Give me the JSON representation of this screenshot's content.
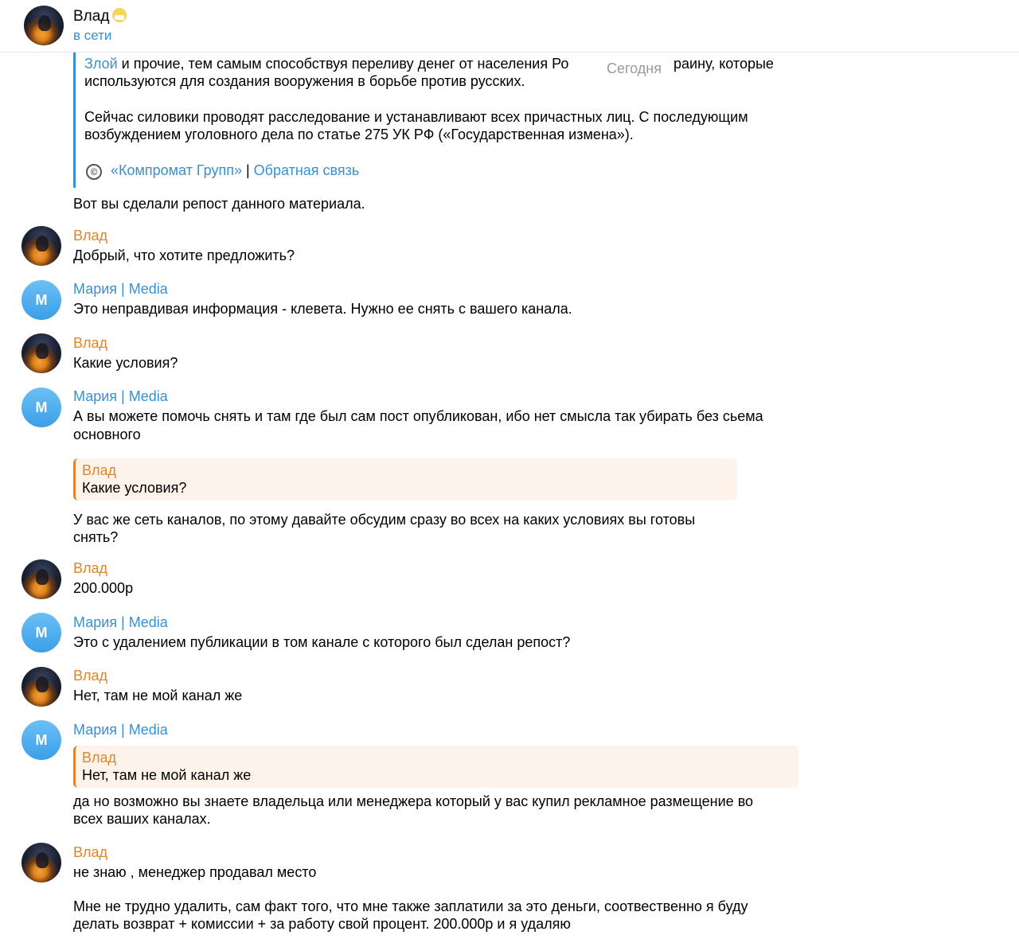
{
  "header": {
    "name": "Влад",
    "status": "в сети"
  },
  "date_divider": "Сегодня",
  "forwarded": {
    "line1_link": "Злой",
    "line1_rest": " и прочие, тем самым способствуя переливу денег от населения Ро",
    "line1_tail": "раину, которые",
    "line2": "используются для создания вооружения в борьбе против русских.",
    "line3": "Сейчас силовики проводят расследование и устанавливают всех причастных лиц. С последующим",
    "line4": "возбуждением уголовного дела по статье 275 УК РФ («Государственная измена»).",
    "copyright_symbol": "©",
    "footer_link1": "«Компромат Групп»",
    "footer_sep": " | ",
    "footer_link2": "Обратная связь"
  },
  "messages": {
    "m0": "Вот вы сделали репост данного материала.",
    "m1_sender": "Влад",
    "m1": "Добрый, что хотите предложить?",
    "m2_sender": "Мария | Media",
    "m2": "Это неправдивая информация - клевета. Нужно ее снять с вашего канала.",
    "m3_sender": "Влад",
    "m3": "Какие условия?",
    "m4_sender": "Мария | Media",
    "m4_line1": "А вы можете помочь снять и там где был сам пост опубликован, ибо нет смысла так убирать без сьема",
    "m4_line2": "основного",
    "m4_reply_sender": "Влад",
    "m4_reply_text": "Какие условия?",
    "m4_line3": "У вас же сеть каналов, по этому давайте обсудим сразу во всех на каких условиях вы готовы",
    "m4_line4": "снять?",
    "m5_sender": "Влад",
    "m5": "200.000р",
    "m6_sender": "Мария | Media",
    "m6": "Это с удалением публикации в том канале с которого был сделан репост?",
    "m7_sender": "Влад",
    "m7": "Нет, там не мой канал же",
    "m8_sender": "Мария | Media",
    "m8_reply_sender": "Влад",
    "m8_reply_text": "Нет, там не мой канал же",
    "m8_line1": "да но возможно вы знаете владельца или менеджера который у вас купил рекламное размещение во",
    "m8_line2": "всех ваших каналах.",
    "m9_sender": "Влад",
    "m9_line1": "не знаю , менеджер продавал место",
    "m9_line2": "Мне не трудно удалить, сам факт того, что мне также заплатили за это деньги, соотвественно я буду",
    "m9_line3": "делать возврат + комиссии + за работу свой процент. 200.000р и я удаляю"
  },
  "avatar_letter": "M",
  "colors": {
    "link_blue": "#3a8fd1",
    "vlad_orange": "#e0862a",
    "reply_bg": "#fdf3ea"
  },
  "icons": {
    "header_emoji": "mask-face-emoji",
    "copyright": "copyright-icon"
  }
}
